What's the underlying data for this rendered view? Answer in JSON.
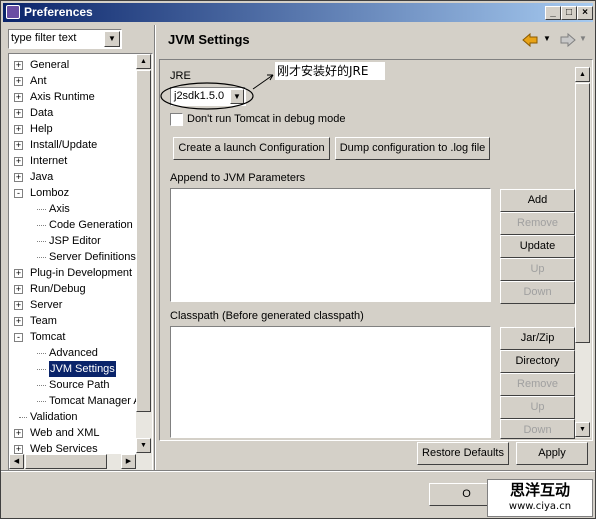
{
  "window": {
    "title": "Preferences"
  },
  "filter": {
    "value": "type filter text"
  },
  "tree": [
    {
      "label": "General",
      "expander": "+"
    },
    {
      "label": "Ant",
      "expander": "+"
    },
    {
      "label": "Axis Runtime",
      "expander": "+"
    },
    {
      "label": "Data",
      "expander": "+"
    },
    {
      "label": "Help",
      "expander": "+"
    },
    {
      "label": "Install/Update",
      "expander": "+"
    },
    {
      "label": "Internet",
      "expander": "+"
    },
    {
      "label": "Java",
      "expander": "+"
    },
    {
      "label": "Lomboz",
      "expander": "-"
    },
    {
      "label": "Axis",
      "expander": ""
    },
    {
      "label": "Code Generation",
      "expander": ""
    },
    {
      "label": "JSP Editor",
      "expander": ""
    },
    {
      "label": "Server Definitions",
      "expander": ""
    },
    {
      "label": "Plug-in Development",
      "expander": "+"
    },
    {
      "label": "Run/Debug",
      "expander": "+"
    },
    {
      "label": "Server",
      "expander": "+"
    },
    {
      "label": "Team",
      "expander": "+"
    },
    {
      "label": "Tomcat",
      "expander": "-"
    },
    {
      "label": "Advanced",
      "expander": ""
    },
    {
      "label": "JVM Settings",
      "expander": "",
      "selected": true
    },
    {
      "label": "Source Path",
      "expander": ""
    },
    {
      "label": "Tomcat Manager A",
      "expander": ""
    },
    {
      "label": "Validation",
      "expander": ""
    },
    {
      "label": "Web and XML",
      "expander": "+"
    },
    {
      "label": "Web Services",
      "expander": "+"
    }
  ],
  "page": {
    "title": "JVM Settings",
    "jre_label": "JRE",
    "jre_value": "j2sdk1.5.0",
    "debug_checkbox": "Don't run Tomcat in debug mode",
    "create_launch": "Create a launch Configuration",
    "dump_config": "Dump configuration to .log file",
    "append_label": "Append to JVM Parameters",
    "classpath_label": "Classpath (Before generated classpath)",
    "param_buttons": {
      "add": "Add",
      "remove": "Remove",
      "update": "Update",
      "up": "Up",
      "down": "Down"
    },
    "classpath_buttons": {
      "jarzip": "Jar/Zip",
      "directory": "Directory",
      "remove": "Remove",
      "up": "Up",
      "down": "Down"
    },
    "restore_defaults": "Restore Defaults",
    "apply": "Apply"
  },
  "annotation": {
    "text": "刚才安装好的JRE"
  },
  "footer": {
    "ok_partial": "O"
  },
  "watermark": {
    "line1": "思洋互动",
    "line2": "www.ciya.cn"
  },
  "icons": [
    "back-arrow-icon",
    "forward-arrow-icon",
    "preferences-icon"
  ],
  "colors": {
    "title_gradient_start": "#0a246a",
    "title_gradient_end": "#a6caf0",
    "selection": "#0a246a",
    "back_arrow": "#e8a317"
  }
}
